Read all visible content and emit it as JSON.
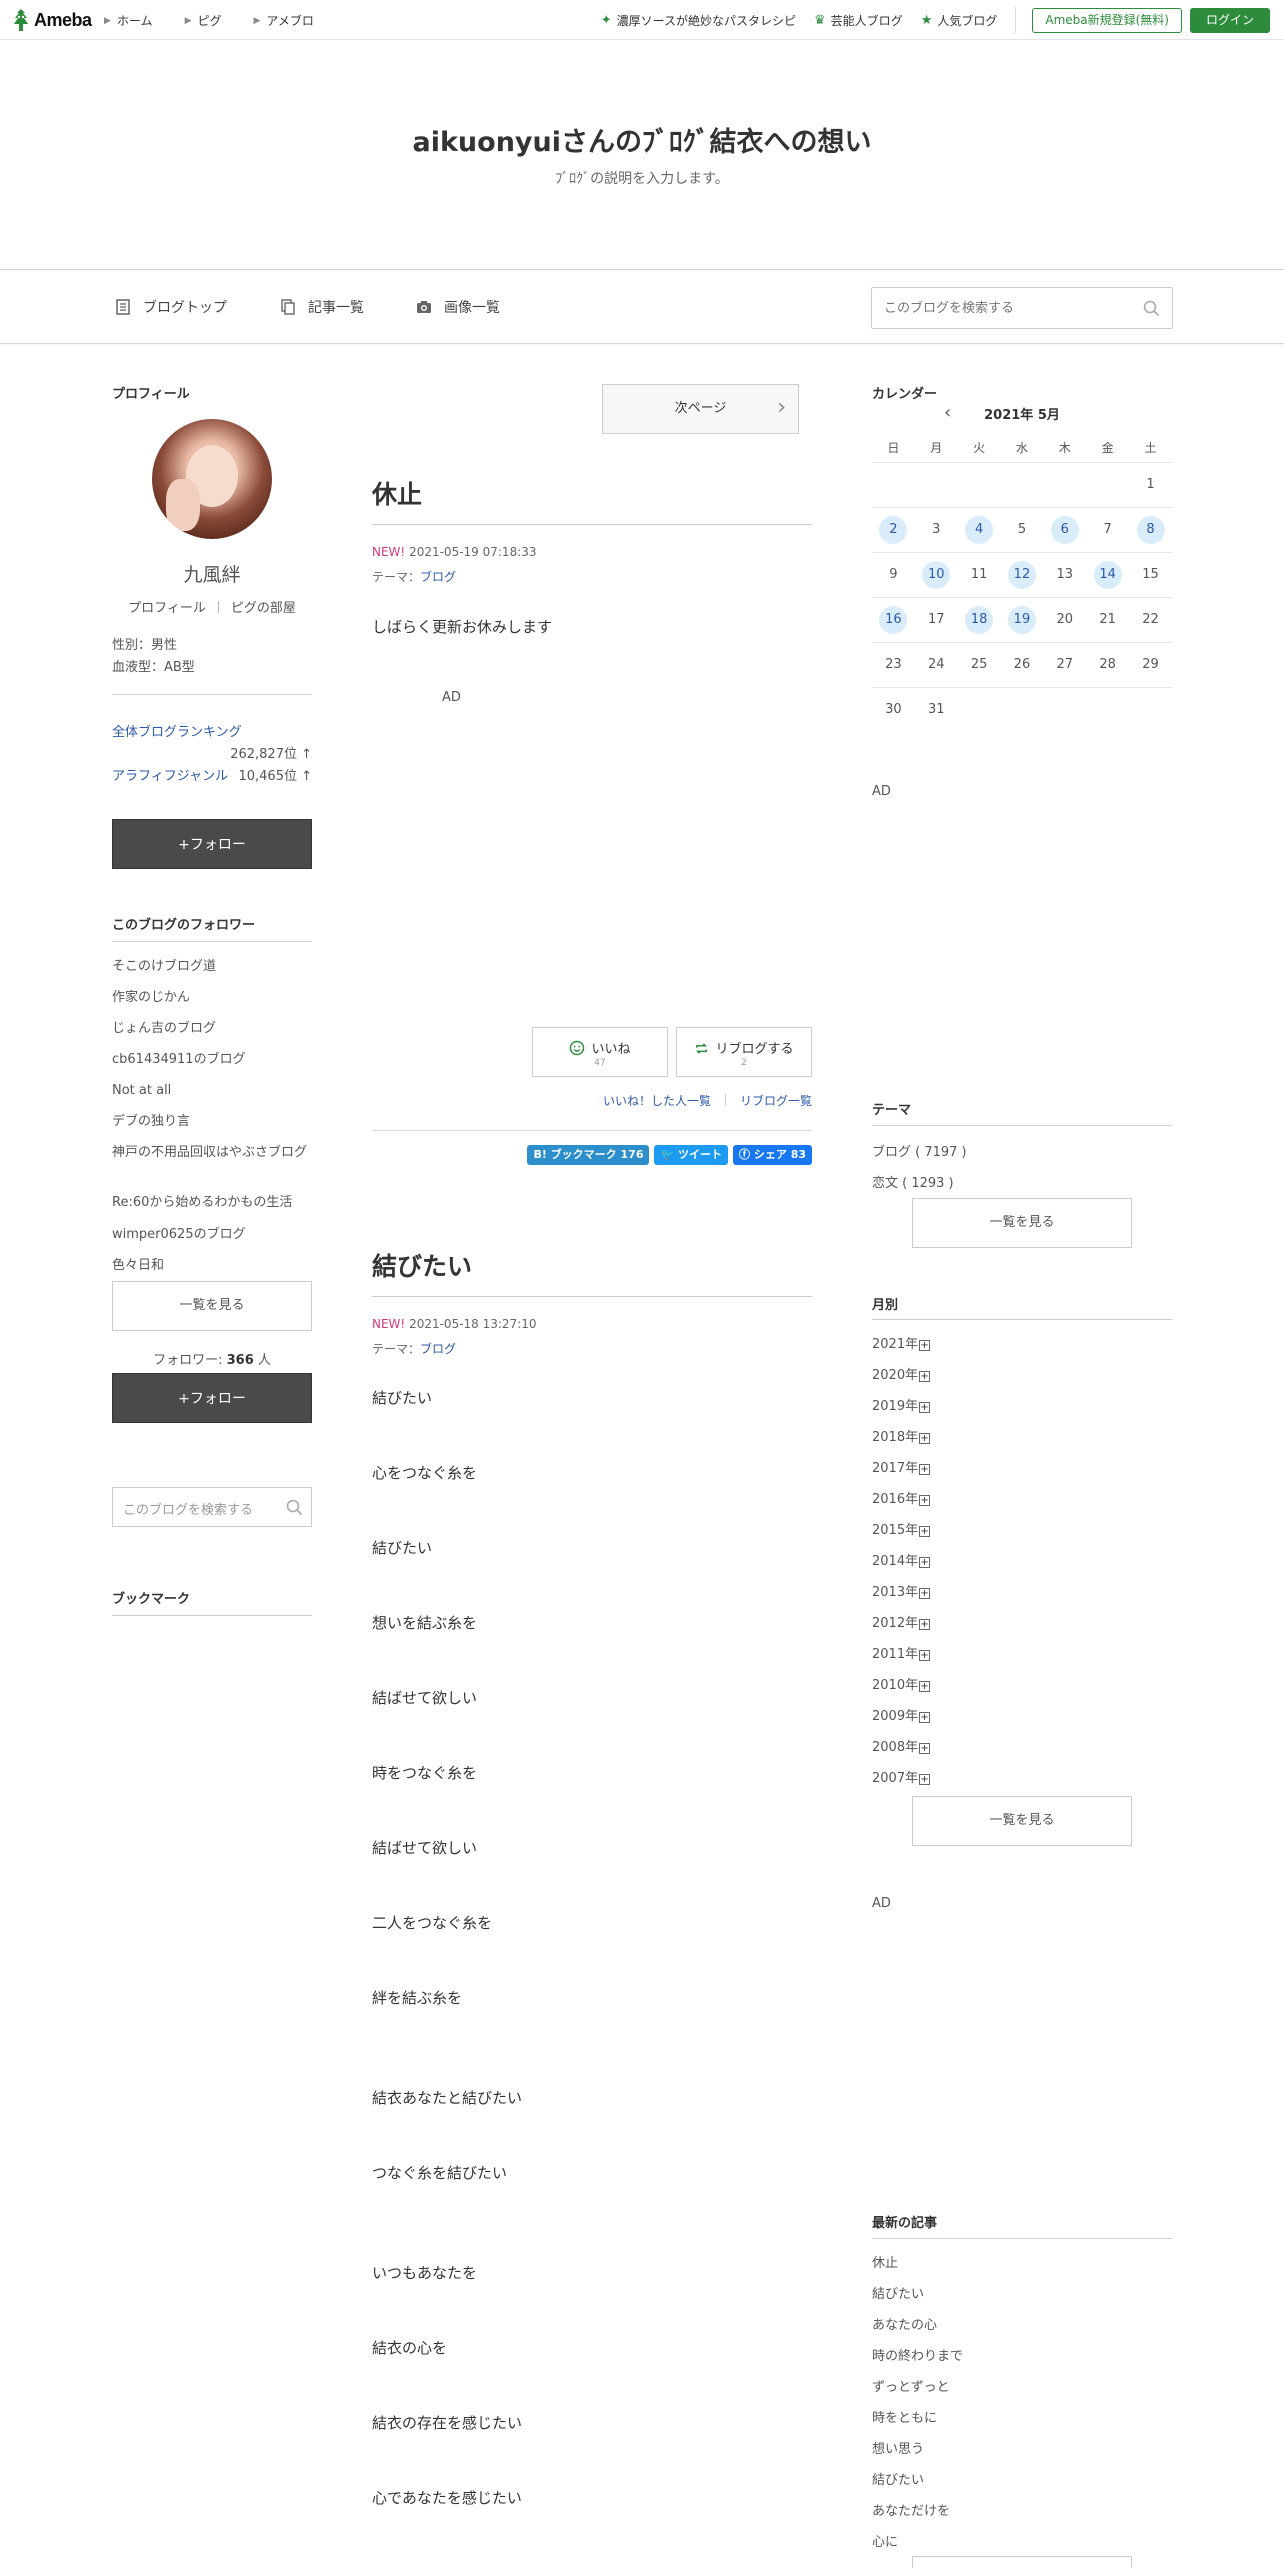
{
  "topbar": {
    "logo_text": "Ameba",
    "nav": [
      "ホーム",
      "ピグ",
      "アメブロ"
    ],
    "links": [
      {
        "label": "濃厚ソースが絶妙なパスタレシピ",
        "icon": "sparkle-icon"
      },
      {
        "label": "芸能人ブログ",
        "icon": "crown-icon"
      },
      {
        "label": "人気ブログ",
        "icon": "star-icon"
      }
    ],
    "register_label": "Ameba新規登録(無料)",
    "login_label": "ログイン",
    "accent_color": "#2d8c3c"
  },
  "header": {
    "title": "aikuonyuiさんのﾌﾞﾛｸﾞ結衣への想い",
    "description": "ﾌﾞﾛｸﾞの説明を入力します。"
  },
  "subnav": {
    "items": [
      "ブログトップ",
      "記事一覧",
      "画像一覧"
    ],
    "search_placeholder": "このブログを検索する"
  },
  "left": {
    "profile_title": "プロフィール",
    "name": "九風絆",
    "profile_link": "プロフィール",
    "pig_link": "ピグの部屋",
    "gender": "性別：男性",
    "blood": "血液型：AB型",
    "ranking_overall_label": "全体ブログランキング",
    "ranking_overall_value": "262,827位 ↑",
    "ranking_genre_label": "アラフィフジャンル",
    "ranking_genre_value": "10,465位 ↑",
    "follow_label": "+フォロー",
    "followers_title": "このブログのフォロワー",
    "followers": [
      "そこのけブログ道",
      "作家のじかん",
      "じょん吉のブログ",
      "cb61434911のブログ",
      "Not at all",
      "デブの独り言",
      "神戸の不用品回収はやぶさブログ",
      "Re:60から始めるわかもの生活",
      "wimper0625のブログ",
      "色々日和"
    ],
    "see_all_label": "一覧を見る",
    "follower_count_prefix": "フォロワー: ",
    "follower_count": "366",
    "follower_count_suffix": " 人",
    "follow_label_2": "+フォロー",
    "search_placeholder": "このブログを検索する",
    "bookmark_title": "ブックマーク"
  },
  "main": {
    "next_page": "次ページ",
    "entries": [
      {
        "title": "休止",
        "new": "NEW!",
        "date": "2021-05-19 07:18:33",
        "theme_prefix": "テーマ：",
        "theme": "ブログ",
        "lines": [
          "しばらく更新お休みします"
        ],
        "ad": "AD",
        "like_label": "いいね",
        "like_count": "47",
        "reblog_label": "リブログする",
        "reblog_count": "2",
        "liked_list": "いいね！した人一覧",
        "reblog_list": "リブログ一覧",
        "share_hatena": "B! ブックマーク 176",
        "share_tweet": "ツイート",
        "share_fb": "シェア 83"
      },
      {
        "title": "結びたい",
        "new": "NEW!",
        "date": "2021-05-18 13:27:10",
        "theme_prefix": "テーマ：",
        "theme": "ブログ",
        "lines": [
          "結びたい",
          "心をつなぐ糸を",
          "結びたい",
          "想いを結ぶ糸を",
          "結ばせて欲しい",
          "時をつなぐ糸を",
          "結ばせて欲しい",
          "二人をつなぐ糸を",
          "絆を結ぶ糸を",
          "結衣あなたと結びたい",
          "つなぐ糸を結びたい",
          "いつもあなたを",
          "結衣の心を",
          "結衣の存在を感じたい",
          "心であなたを感じたい"
        ]
      }
    ]
  },
  "right": {
    "calendar_title": "カレンダー",
    "month": "2021年 5月",
    "weekdays": [
      "日",
      "月",
      "火",
      "水",
      "木",
      "金",
      "土"
    ],
    "weeks": [
      [
        "",
        "",
        "",
        "",
        "",
        "",
        "1"
      ],
      [
        "2",
        "3",
        "4",
        "5",
        "6",
        "7",
        "8"
      ],
      [
        "9",
        "10",
        "11",
        "12",
        "13",
        "14",
        "15"
      ],
      [
        "16",
        "17",
        "18",
        "19",
        "20",
        "21",
        "22"
      ],
      [
        "23",
        "24",
        "25",
        "26",
        "27",
        "28",
        "29"
      ],
      [
        "30",
        "31",
        "",
        "",
        "",
        "",
        ""
      ]
    ],
    "highlighted_days": [
      "2",
      "4",
      "6",
      "8",
      "10",
      "12",
      "14",
      "16",
      "18",
      "19"
    ],
    "ad": "AD",
    "theme_title": "テーマ",
    "themes": [
      "ブログ ( 7197 )",
      "恋文 ( 1293 )"
    ],
    "see_all_label": "一覧を見る",
    "monthly_title": "月別",
    "years": [
      "2021年",
      "2020年",
      "2019年",
      "2018年",
      "2017年",
      "2016年",
      "2015年",
      "2014年",
      "2013年",
      "2012年",
      "2011年",
      "2010年",
      "2009年",
      "2008年",
      "2007年"
    ],
    "ad2": "AD",
    "recent_title": "最新の記事",
    "recent": [
      "休止",
      "結びたい",
      "あなたの心",
      "時の終わりまで",
      "ずっとずっと",
      "時をともに",
      "想い思う",
      "結びたい",
      "あなただけを",
      "心に"
    ]
  }
}
